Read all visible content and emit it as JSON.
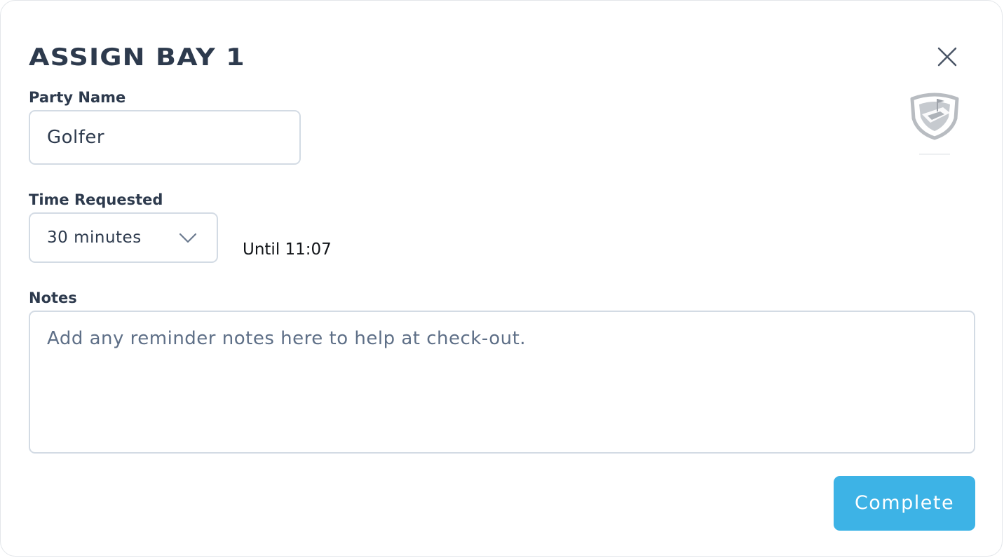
{
  "dialog": {
    "title": "ASSIGN BAY 1",
    "close_icon": "close-icon",
    "logo_icon": "topgolf-shield-logo-icon"
  },
  "form": {
    "party_name": {
      "label": "Party Name",
      "value": "Golfer"
    },
    "time_requested": {
      "label": "Time Requested",
      "selected": "30 minutes",
      "until_text": "Until 11:07",
      "icon": "chevron-down-icon"
    },
    "notes": {
      "label": "Notes",
      "placeholder": "Add any reminder notes here to help at check-out.",
      "value": ""
    }
  },
  "actions": {
    "complete_label": "Complete"
  },
  "colors": {
    "heading": "#2d3a4d",
    "border": "#d3dbe4",
    "placeholder": "#5e6f87",
    "primary": "#3db3e6",
    "logo": "#b8bcc1"
  }
}
